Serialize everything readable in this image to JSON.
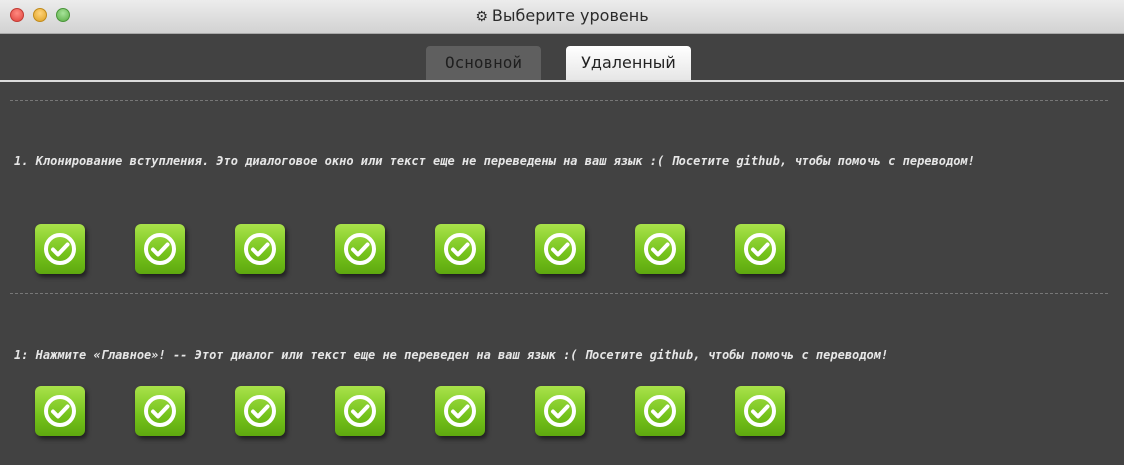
{
  "window": {
    "title": "Выберите уровень",
    "title_icon": "gear-icon"
  },
  "tabs": [
    {
      "label": "Основной",
      "active": false
    },
    {
      "label": "Удаленный",
      "active": true
    }
  ],
  "sections": [
    {
      "text": "1. Клонирование вступления. Это диалоговое окно или текст еще не переведены на ваш язык :( Посетите github, чтобы помочь с переводом!",
      "levels": [
        {
          "icon": "check-circle-icon",
          "completed": true
        },
        {
          "icon": "check-circle-icon",
          "completed": true
        },
        {
          "icon": "check-circle-icon",
          "completed": true
        },
        {
          "icon": "check-circle-icon",
          "completed": true
        },
        {
          "icon": "check-circle-icon",
          "completed": true
        },
        {
          "icon": "check-circle-icon",
          "completed": true
        },
        {
          "icon": "check-circle-icon",
          "completed": true
        },
        {
          "icon": "check-circle-icon",
          "completed": true
        }
      ]
    },
    {
      "text": "1: Нажмите «Главное»! -- Этот диалог или текст еще не переведен на ваш язык :( Посетите github, чтобы помочь с переводом!",
      "levels": [
        {
          "icon": "check-circle-icon",
          "completed": true
        },
        {
          "icon": "check-circle-icon",
          "completed": true
        },
        {
          "icon": "check-circle-icon",
          "completed": true
        },
        {
          "icon": "check-circle-icon",
          "completed": true
        },
        {
          "icon": "check-circle-icon",
          "completed": true
        },
        {
          "icon": "check-circle-icon",
          "completed": true
        },
        {
          "icon": "check-circle-icon",
          "completed": true
        },
        {
          "icon": "check-circle-icon",
          "completed": true
        }
      ]
    }
  ],
  "colors": {
    "background": "#424242",
    "level_green": "#74c21b",
    "text": "#e6e6e6"
  }
}
